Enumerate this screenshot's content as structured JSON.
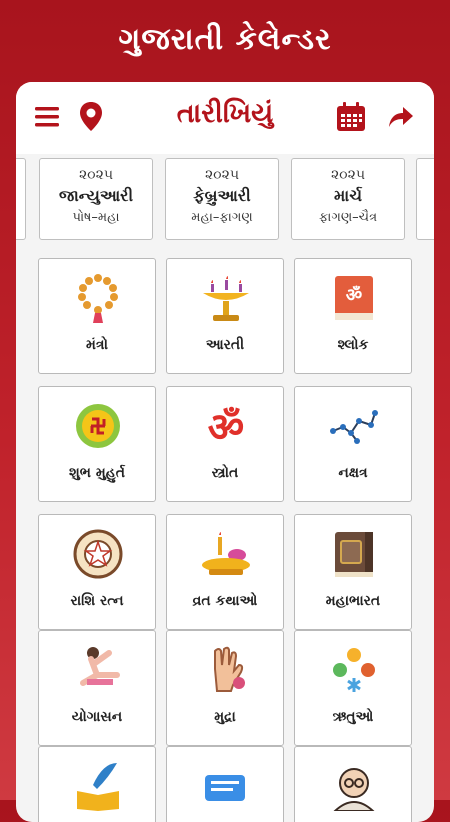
{
  "promo": {
    "title": "ગુજરાતી કેલેન્ડર"
  },
  "appbar": {
    "title": "તારીખિયું",
    "icons": [
      "menu-icon",
      "location-pin-icon",
      "calendar-icon",
      "share-icon"
    ]
  },
  "months": [
    {
      "year": "૨૦૨૫",
      "name": "જાન્યુઆરી",
      "sub": "પોષ–મહા"
    },
    {
      "year": "૨૦૨૫",
      "name": "ફેબ્રુઆરી",
      "sub": "મહા–ફાગણ"
    },
    {
      "year": "૨૦૨૫",
      "name": "માર્ચ",
      "sub": "ફાગણ–ચૈત્ર"
    }
  ],
  "tiles": [
    {
      "label": "મંત્રો",
      "icon": "mala-beads-icon"
    },
    {
      "label": "આરતી",
      "icon": "aarti-lamp-icon"
    },
    {
      "label": "શ્લોક",
      "icon": "scripture-book-icon"
    },
    {
      "label": "શુભ મુહુર્ત",
      "icon": "swastika-icon"
    },
    {
      "label": "સ્ત્રોત",
      "icon": "om-icon"
    },
    {
      "label": "નક્ષત્ર",
      "icon": "constellation-icon"
    },
    {
      "label": "રાશિ રત્ન",
      "icon": "zodiac-wheel-icon"
    },
    {
      "label": "વ્રત કથાઓ",
      "icon": "puja-thali-icon"
    },
    {
      "label": "મહાભારત",
      "icon": "mahabharat-book-icon"
    },
    {
      "label": "યોગાસન",
      "icon": "yoga-pose-icon"
    },
    {
      "label": "મુદ્રા",
      "icon": "hand-mudra-icon"
    },
    {
      "label": "ઋતુઓ",
      "icon": "seasons-icon"
    }
  ],
  "partial_tiles": [
    "quill-book-icon",
    "chat-bubble-icon",
    "gandhi-portrait-icon"
  ],
  "colors": {
    "brand": "#b3131b",
    "background": "#c0222b",
    "surface": "#f4f4f4"
  }
}
